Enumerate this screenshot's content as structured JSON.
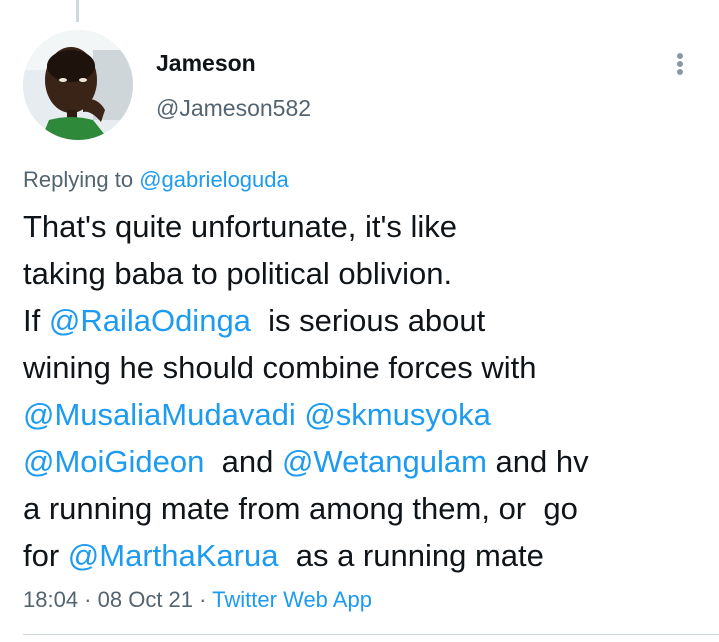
{
  "author": {
    "name": "Jameson",
    "handle": "@Jameson582"
  },
  "reply": {
    "prefix": "Replying to ",
    "target": "@gabrieloguda"
  },
  "tweet": {
    "line1": "That's quite unfortunate, it's like",
    "line2": "taking baba to political oblivion.",
    "line3_a": "If ",
    "mention1": "@RailaOdinga",
    "line3_b": "  is serious about",
    "line4": "wining he should combine forces with",
    "mention2": "@MusaliaMudavadi",
    "line5_space": " ",
    "mention3": "@skmusyoka",
    "mention4": "@MoiGideon",
    "line6_a": "  and ",
    "mention5": "@Wetangulam",
    "line6_b": " and hv",
    "line7": "a running mate from among them, or  go",
    "line8_a": "for ",
    "mention6": "@MarthaKarua",
    "line8_b": "  as a running mate"
  },
  "meta": {
    "time": "18:04",
    "sep1": " · ",
    "date": "08 Oct 21",
    "sep2": " · ",
    "source": "Twitter Web App"
  },
  "icons": {
    "more": "more-vertical-icon",
    "avatar": "avatar-image"
  },
  "colors": {
    "link": "#1d9bf0",
    "secondary_text": "#536471",
    "primary_text": "#0f1419",
    "divider": "#cfd9de"
  }
}
